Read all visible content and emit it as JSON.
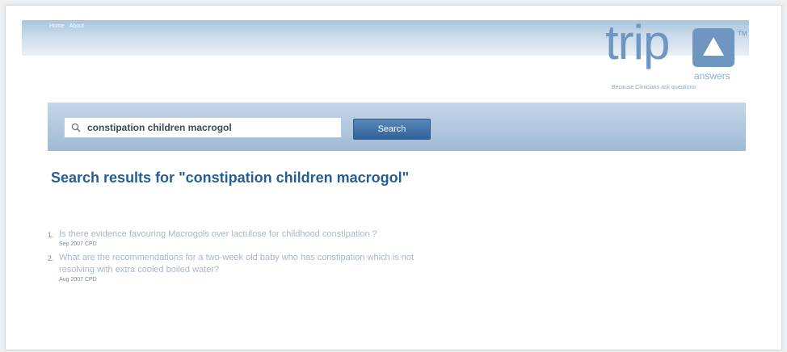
{
  "topnav": {
    "items": [
      "Home",
      "About"
    ]
  },
  "logo": {
    "word": "trip",
    "tm": "TM",
    "sub": "answers",
    "tagline": "Because Clinicians ask questions"
  },
  "search": {
    "query": "constipation children macrogol",
    "button_label": "Search"
  },
  "results": {
    "title": "Search results for \"constipation children macrogol\"",
    "items": [
      {
        "num": "1.",
        "question": "Is there evidence favouring Macrogols over lactulose for childhood constipation ?",
        "date": "Sep 2007",
        "tag": "CPD"
      },
      {
        "num": "2.",
        "question": "What are the recommendations for a two-week old baby who has constipation which is not resolving with extra cooled boiled water?",
        "date": "Aug 2007",
        "tag": "CPD"
      }
    ]
  },
  "colors": {
    "accent": "#245e95",
    "logo": "#6f96c0",
    "button": "#3a6ba3",
    "link": "#a7b8c9"
  }
}
